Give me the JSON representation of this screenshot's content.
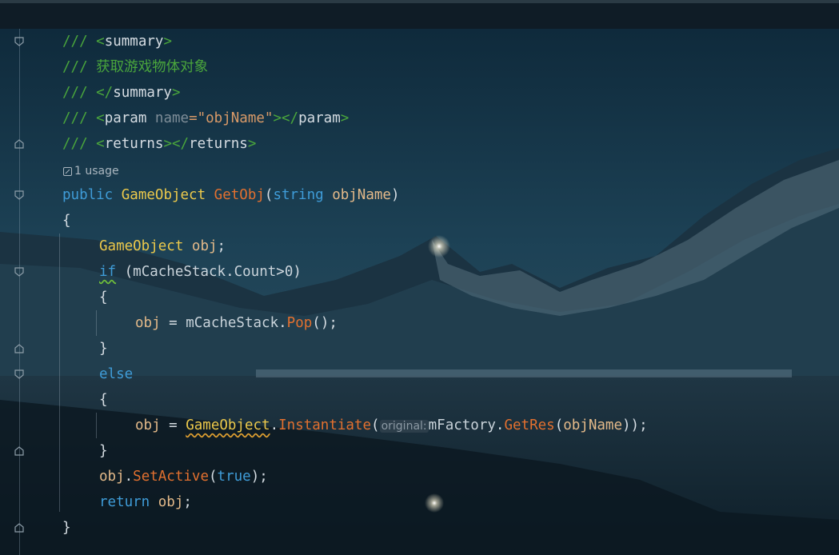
{
  "editor": {
    "usage_hint": "1 usage",
    "param_hint_label": "original:"
  },
  "code": {
    "l1": [
      "///",
      " <",
      "summary",
      ">"
    ],
    "l2": [
      "/// ",
      "获取游戏物体对象"
    ],
    "l3": [
      "///",
      " </",
      "summary",
      ">"
    ],
    "l4": [
      "///",
      " <",
      "param",
      " name",
      "=\"",
      "objName",
      "\"",
      "></",
      "param",
      ">"
    ],
    "l5": [
      "///",
      " <",
      "returns",
      "></",
      "returns",
      ">"
    ],
    "l6": [
      "public",
      " ",
      "GameObject",
      " ",
      "GetObj",
      "(",
      "string",
      " ",
      "objName",
      ")"
    ],
    "l7": "{",
    "l8": [
      "GameObject",
      " ",
      "obj",
      ";"
    ],
    "l9": [
      "if",
      " (",
      "mCacheStack",
      ".",
      "Count",
      ">",
      "0",
      ")"
    ],
    "l10": "{",
    "l11": [
      "obj",
      " = ",
      "mCacheStack",
      ".",
      "Pop",
      "();"
    ],
    "l12": "}",
    "l13": "else",
    "l14": "{",
    "l15": [
      "obj",
      " = ",
      "GameObject",
      ".",
      "Instantiate",
      "(",
      "mFactory",
      ".",
      "GetRes",
      "(",
      "objName",
      "));"
    ],
    "l16": "}",
    "l17": [
      "obj",
      ".",
      "SetActive",
      "(",
      "true",
      ");"
    ],
    "l18": [
      "return",
      " ",
      "obj",
      ";"
    ],
    "l19": "}"
  }
}
